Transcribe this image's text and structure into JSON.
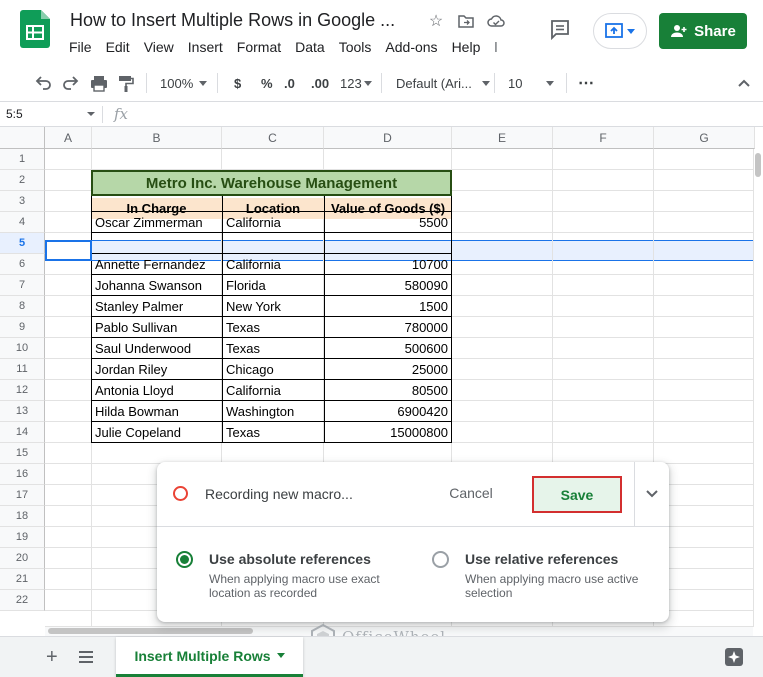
{
  "app": {
    "title": "How to Insert Multiple Rows in Google ...",
    "menu": [
      "File",
      "Edit",
      "View",
      "Insert",
      "Format",
      "Data",
      "Tools",
      "Add-ons",
      "Help",
      "l"
    ],
    "share_label": "Share",
    "colors": {
      "accent_green": "#188038",
      "selection_blue": "#1a73e8"
    }
  },
  "toolbar": {
    "zoom": "100%",
    "currency": "$",
    "percent": "%",
    "decrease_decimal": ".0",
    "increase_decimal": ".00",
    "number_format": "123",
    "font": "Default (Ari...",
    "font_size": "10",
    "more": "⋯"
  },
  "formula_bar": {
    "name_box": "5:5",
    "fx": "fx"
  },
  "grid": {
    "columns": [
      "A",
      "B",
      "C",
      "D",
      "E",
      "F",
      "G"
    ],
    "rows": [
      "1",
      "2",
      "3",
      "4",
      "5",
      "6",
      "7",
      "8",
      "9",
      "10",
      "11",
      "12",
      "13",
      "14",
      "15",
      "16",
      "17",
      "18",
      "19",
      "20",
      "21",
      "22"
    ],
    "selected_row": "5"
  },
  "table": {
    "title": "Metro Inc. Warehouse Management",
    "headers": [
      "In Charge",
      "Location",
      "Value of Goods ($)"
    ],
    "rows": [
      [
        "Oscar Zimmerman",
        "California",
        "5500"
      ],
      [
        "",
        "",
        ""
      ],
      [
        "Annette Fernandez",
        "California",
        "10700"
      ],
      [
        "Johanna Swanson",
        "Florida",
        "580090"
      ],
      [
        "Stanley Palmer",
        "New York",
        "1500"
      ],
      [
        "Pablo Sullivan",
        "Texas",
        "780000"
      ],
      [
        "Saul Underwood",
        "Texas",
        "500600"
      ],
      [
        "Jordan Riley",
        "Chicago",
        "25000"
      ],
      [
        "Antonia Lloyd",
        "California",
        "80500"
      ],
      [
        "Hilda Bowman",
        "Washington",
        "6900420"
      ],
      [
        "Julie Copeland",
        "Texas",
        "15000800"
      ]
    ]
  },
  "macro_dialog": {
    "status": "Recording new macro...",
    "cancel_label": "Cancel",
    "save_label": "Save",
    "options": [
      {
        "title": "Use absolute references",
        "desc": "When applying macro use exact location as recorded",
        "selected": true
      },
      {
        "title": "Use relative references",
        "desc": "When applying macro use active selection",
        "selected": false
      }
    ]
  },
  "sheet_tab": {
    "label": "Insert Multiple Rows"
  },
  "watermark": "OfficeWheel"
}
